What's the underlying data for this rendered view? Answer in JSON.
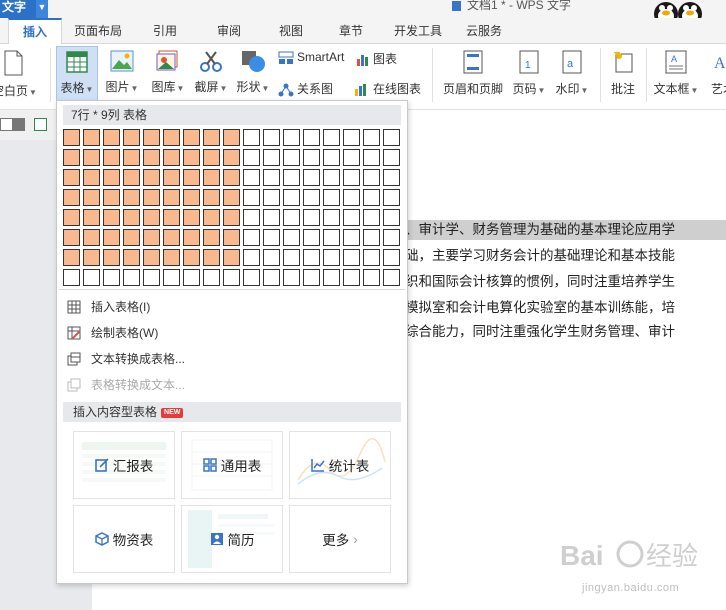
{
  "window": {
    "app_button_label": "文字",
    "doc_title": "文档1 * - WPS 文字"
  },
  "tabs": [
    {
      "label": "插入",
      "active": true
    },
    {
      "label": "页面布局"
    },
    {
      "label": "引用"
    },
    {
      "label": "审阅"
    },
    {
      "label": "视图"
    },
    {
      "label": "章节"
    },
    {
      "label": "开发工具"
    },
    {
      "label": "云服务"
    }
  ],
  "ribbon": {
    "blank_page": "空白页",
    "table": "表格",
    "picture": "图片",
    "gallery": "图库",
    "screenshot": "截屏",
    "shapes": "形状",
    "smartart": "SmartArt",
    "chart": "图表",
    "relation_graph": "关系图",
    "online_chart": "在线图表",
    "header_footer": "页眉和页脚",
    "page_number": "页码",
    "watermark": "水印",
    "comment": "批注",
    "textbox": "文本框",
    "art_text": "艺术"
  },
  "dropdown": {
    "grid_caption": "7行 * 9列 表格",
    "grid": {
      "rows": 8,
      "cols": 17,
      "selected_rows": 7,
      "selected_cols": 9
    },
    "menu": [
      {
        "label": "插入表格(I)",
        "icon": "insert-table-icon",
        "disabled": false
      },
      {
        "label": "绘制表格(W)",
        "icon": "draw-table-icon",
        "disabled": false
      },
      {
        "label": "文本转换成表格...",
        "icon": "text-to-table-icon",
        "disabled": false
      },
      {
        "label": "表格转换成文本...",
        "icon": "table-to-text-icon",
        "disabled": true
      }
    ],
    "content_tables_header": "插入内容型表格",
    "new_badge": "NEW",
    "cards": [
      {
        "label": "汇报表",
        "icon": "report-icon"
      },
      {
        "label": "通用表",
        "icon": "grid-icon"
      },
      {
        "label": "统计表",
        "icon": "line-chart-icon"
      },
      {
        "label": "物资表",
        "icon": "box-icon"
      },
      {
        "label": "简历",
        "icon": "resume-icon"
      },
      {
        "label": "更多",
        "icon": "chevron-right-icon"
      }
    ]
  },
  "document": {
    "lines": [
      "、审计学、财务管理为基础的基本理论应用学",
      "础，主要学习财务会计的基础理论和基本技能",
      "织和国际会计核算的惯例，同时注重培养学生",
      "模拟室和会计电算化实验室的基本训练能，培",
      "综合能力，同时注重强化学生财务管理、审计"
    ]
  },
  "watermark_text": "jingyan.baidu.com",
  "colors": {
    "accent": "#2b71c7",
    "grid_selected": "#f7b98d",
    "new_badge": "#e23e3e"
  }
}
